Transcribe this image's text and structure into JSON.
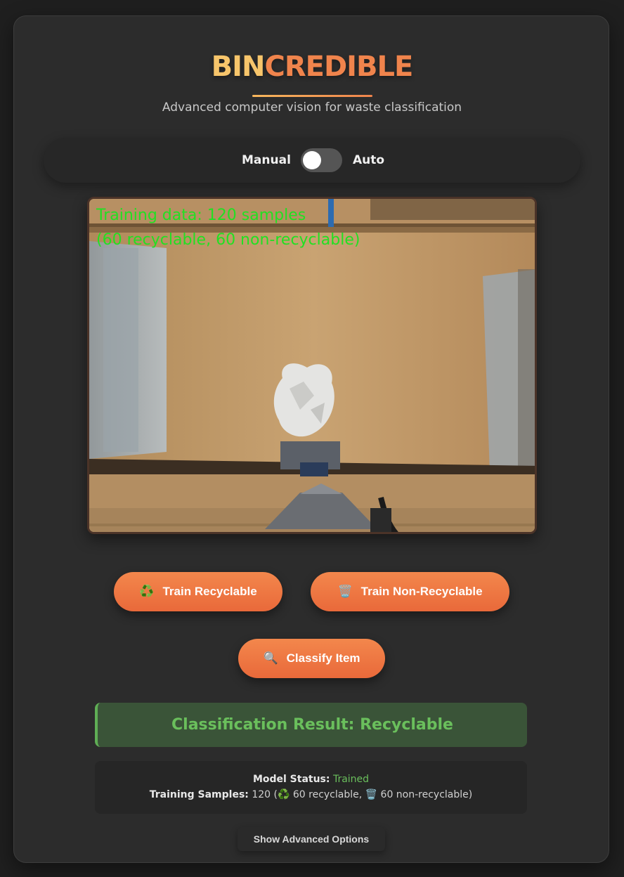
{
  "header": {
    "brand_part1": "BIN",
    "brand_part2": "CREDIBLE",
    "subtitle": "Advanced computer vision for waste classification"
  },
  "mode": {
    "manual_label": "Manual",
    "auto_label": "Auto",
    "auto_enabled": false
  },
  "camera": {
    "overlay_line1": "Training data: 120 samples",
    "overlay_line2": "(60 recyclable, 60 non-recyclable)"
  },
  "actions": {
    "train_recyclable_icon": "♻️",
    "train_recyclable_label": "Train Recyclable",
    "train_nonrecyclable_icon": "🗑️",
    "train_nonrecyclable_label": "Train Non-Recyclable",
    "classify_icon": "🔍",
    "classify_label": "Classify Item"
  },
  "result": {
    "text": "Classification Result: Recyclable"
  },
  "status": {
    "model_status_label": "Model Status:",
    "model_status_value": "Trained",
    "samples_label": "Training Samples:",
    "samples_total": "120 (",
    "recyclable_icon": "♻️",
    "recyclable_text": "60 recyclable,",
    "nonrecyclable_icon": "🗑️",
    "nonrecyclable_text": "60 non-recyclable)"
  },
  "advanced": {
    "label": "Show Advanced Options"
  },
  "colors": {
    "brand_gold": "#f7c56b",
    "brand_orange": "#f0844c",
    "button_orange": "#ee7742",
    "success_green": "#6abf5c",
    "overlay_green": "#22e022"
  }
}
